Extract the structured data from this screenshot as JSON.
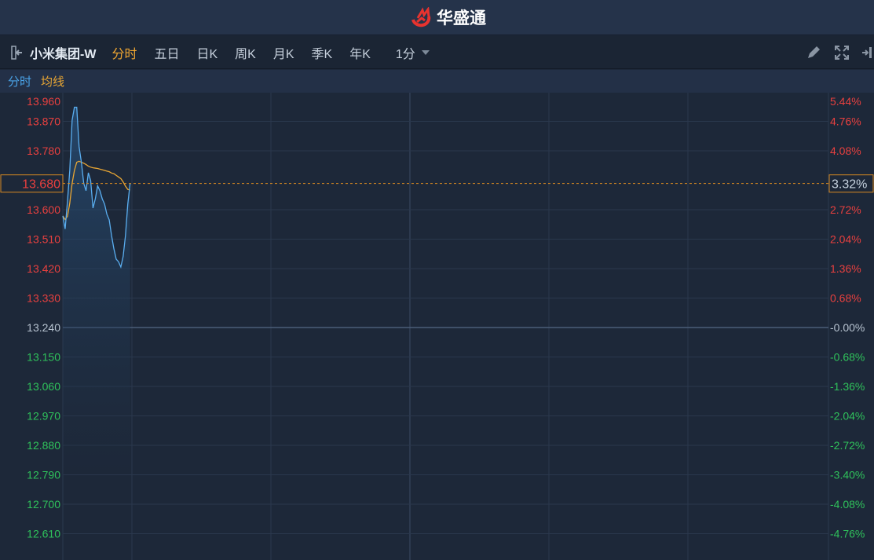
{
  "header": {
    "brand": "华盛通",
    "logo_icon": "huashengtong-logo"
  },
  "toolbar": {
    "stock_name": "小米集团-W",
    "tabs": [
      "分时",
      "五日",
      "日K",
      "周K",
      "月K",
      "季K",
      "年K"
    ],
    "active_tab": "分时",
    "period": "1分",
    "icons": [
      "collapse-panel-icon",
      "pencil-icon",
      "fullscreen-icon",
      "expand-right-icon"
    ]
  },
  "legend": {
    "price_label": "分时",
    "avg_label": "均线"
  },
  "colors": {
    "up": "#e8403f",
    "down": "#2fc25b",
    "neutral": "#b7c3d0",
    "price_line": "#5aaef0",
    "avg_line": "#e8a634",
    "current": "#d98a22"
  },
  "chart_data": {
    "type": "line",
    "prev_close": 13.24,
    "current_price": 13.68,
    "current_price_label": "13.680",
    "current_pct_label": "3.32%",
    "session_minutes": 330,
    "ylim": [
      12.57,
      13.987
    ],
    "left_ticks": [
      "13.960",
      "13.870",
      "13.780",
      "13.600",
      "13.510",
      "13.420",
      "13.330",
      "13.240",
      "13.150",
      "13.060",
      "12.970",
      "12.880",
      "12.790",
      "12.700",
      "12.610"
    ],
    "left_tick_values": [
      13.96,
      13.87,
      13.78,
      13.6,
      13.51,
      13.42,
      13.33,
      13.24,
      13.15,
      13.06,
      12.97,
      12.88,
      12.79,
      12.7,
      12.61
    ],
    "right_ticks": [
      "5.44%",
      "4.76%",
      "4.08%",
      "2.72%",
      "2.04%",
      "1.36%",
      "0.68%",
      "-0.00%",
      "-0.68%",
      "-1.36%",
      "-2.04%",
      "-2.72%",
      "-3.40%",
      "-4.08%",
      "-4.76%"
    ],
    "price": [
      13.581,
      13.541,
      13.625,
      13.721,
      13.873,
      13.913,
      13.913,
      13.793,
      13.745,
      13.681,
      13.658,
      13.713,
      13.689,
      13.605,
      13.633,
      13.673,
      13.658,
      13.633,
      13.617,
      13.586,
      13.569,
      13.521,
      13.481,
      13.449,
      13.441,
      13.425,
      13.457,
      13.521,
      13.617,
      13.68
    ],
    "avg": [
      13.581,
      13.57,
      13.58,
      13.62,
      13.68,
      13.72,
      13.745,
      13.748,
      13.745,
      13.742,
      13.738,
      13.733,
      13.73,
      13.728,
      13.727,
      13.726,
      13.724,
      13.722,
      13.72,
      13.718,
      13.716,
      13.712,
      13.71,
      13.705,
      13.7,
      13.695,
      13.685,
      13.672,
      13.662,
      13.66
    ]
  }
}
